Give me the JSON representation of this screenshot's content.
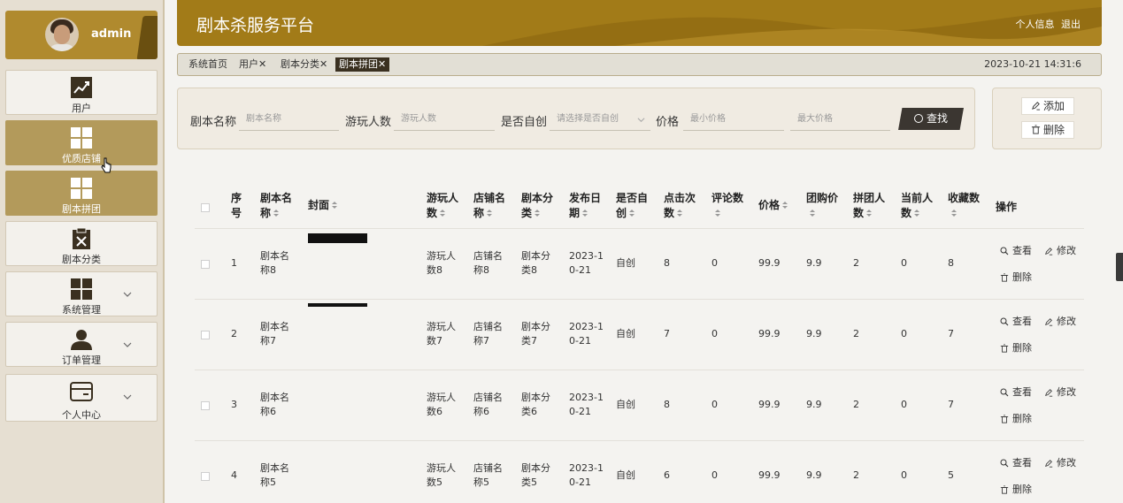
{
  "app": {
    "title": "剧本杀服务平台",
    "links": [
      "个人信息",
      "退出"
    ]
  },
  "user": {
    "name": "admin"
  },
  "sidebar": {
    "items": [
      {
        "label": "用户",
        "icon": "chart-icon"
      },
      {
        "label": "优质店铺",
        "icon": "grid-icon"
      },
      {
        "label": "剧本拼团",
        "icon": "grid-icon"
      },
      {
        "label": "剧本分类",
        "icon": "clipboard-icon"
      },
      {
        "label": "系统管理",
        "icon": "grid-icon"
      },
      {
        "label": "订单管理",
        "icon": "user-icon"
      },
      {
        "label": "个人中心",
        "icon": "card-icon"
      }
    ]
  },
  "tabs": [
    {
      "label": "系统首页"
    },
    {
      "label": "用户✕"
    },
    {
      "label": "剧本分类✕"
    },
    {
      "label": "剧本拼团✕"
    }
  ],
  "datetime": "2023-10-21 14:31:6",
  "search": {
    "name_label": "剧本名称",
    "name_placeholder": "剧本名称",
    "players_label": "游玩人数",
    "players_placeholder": "游玩人数",
    "original_label": "是否自创",
    "original_placeholder": "请选择是否自创",
    "price_label": "价格",
    "price_min_placeholder": "最小价格",
    "price_max_placeholder": "最大价格",
    "search_button": "查找"
  },
  "actions": {
    "add": "添加",
    "delete": "删除"
  },
  "table": {
    "headers": {
      "index": [
        "序",
        "号"
      ],
      "name": [
        "剧本名",
        "称"
      ],
      "cover": "封面",
      "players": [
        "游玩人",
        "数"
      ],
      "shop": [
        "店铺名",
        "称"
      ],
      "category": [
        "剧本分",
        "类"
      ],
      "date": [
        "发布日",
        "期"
      ],
      "original": [
        "是否自",
        "创"
      ],
      "clicks": [
        "点击次",
        "数"
      ],
      "comments": "评论数",
      "price": "价格",
      "group_price": [
        "团购价"
      ],
      "group_people": [
        "拼团人",
        "数"
      ],
      "current_people": [
        "当前人",
        "数"
      ],
      "favorites": [
        "收藏数"
      ],
      "ops": "操作"
    },
    "rows": [
      {
        "index": "1",
        "name": [
          "剧本名",
          "称8"
        ],
        "players": [
          "游玩人",
          "数8"
        ],
        "shop": [
          "店铺名",
          "称8"
        ],
        "category": [
          "剧本分",
          "类8"
        ],
        "date": [
          "2023-1",
          "0-21"
        ],
        "original": "自创",
        "clicks": "8",
        "comments": "0",
        "price": "99.9",
        "group_price": "9.9",
        "group_people": "2",
        "current_people": "0",
        "favorites": "8"
      },
      {
        "index": "2",
        "name": [
          "剧本名",
          "称7"
        ],
        "players": [
          "游玩人",
          "数7"
        ],
        "shop": [
          "店铺名",
          "称7"
        ],
        "category": [
          "剧本分",
          "类7"
        ],
        "date": [
          "2023-1",
          "0-21"
        ],
        "original": "自创",
        "clicks": "7",
        "comments": "0",
        "price": "99.9",
        "group_price": "9.9",
        "group_people": "2",
        "current_people": "0",
        "favorites": "7"
      },
      {
        "index": "3",
        "name": [
          "剧本名",
          "称6"
        ],
        "players": [
          "游玩人",
          "数6"
        ],
        "shop": [
          "店铺名",
          "称6"
        ],
        "category": [
          "剧本分",
          "类6"
        ],
        "date": [
          "2023-1",
          "0-21"
        ],
        "original": "自创",
        "clicks": "8",
        "comments": "0",
        "price": "99.9",
        "group_price": "9.9",
        "group_people": "2",
        "current_people": "0",
        "favorites": "7"
      },
      {
        "index": "4",
        "name": [
          "剧本名",
          "称5"
        ],
        "players": [
          "游玩人",
          "数5"
        ],
        "shop": [
          "店铺名",
          "称5"
        ],
        "category": [
          "剧本分",
          "类5"
        ],
        "date": [
          "2023-1",
          "0-21"
        ],
        "original": "自创",
        "clicks": "6",
        "comments": "0",
        "price": "99.9",
        "group_price": "9.9",
        "group_people": "2",
        "current_people": "0",
        "favorites": "5"
      }
    ],
    "row_ops": {
      "view": "查看",
      "edit": "修改",
      "delete": "删除"
    }
  },
  "colors": {
    "brand": "#a27b18",
    "sidebar_active": "#b39a5b",
    "dark_button": "#3b3631"
  }
}
